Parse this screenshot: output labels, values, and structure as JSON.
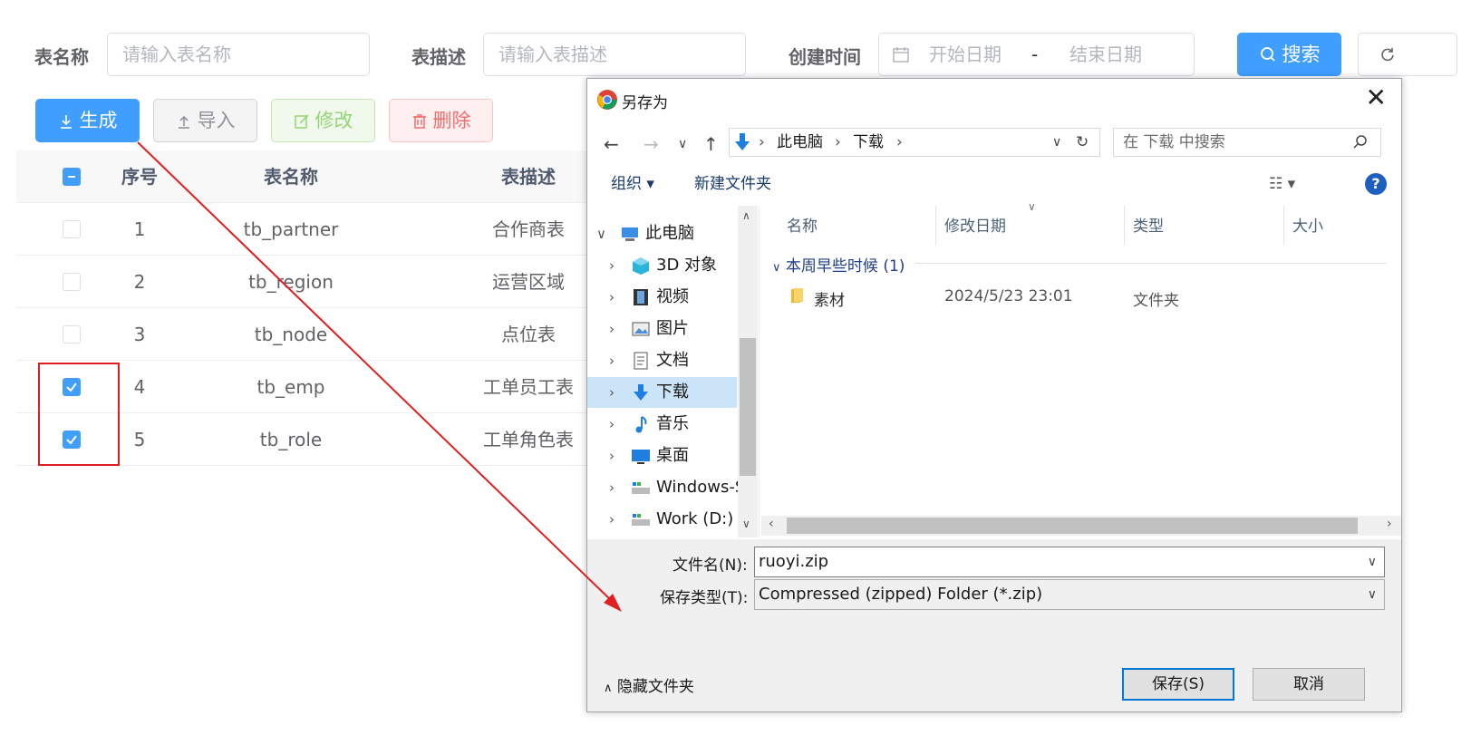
{
  "filter": {
    "table_name_label": "表名称",
    "table_name_placeholder": "请输入表名称",
    "table_desc_label": "表描述",
    "table_desc_placeholder": "请输入表描述",
    "create_time_label": "创建时间",
    "start_date_placeholder": "开始日期",
    "range_separator": "-",
    "end_date_placeholder": "结束日期",
    "search_button": "搜索"
  },
  "actions": {
    "generate": "生成",
    "import": "导入",
    "edit": "修改",
    "delete": "删除"
  },
  "table": {
    "headers": {
      "index": "序号",
      "name": "表名称",
      "desc": "表描述"
    },
    "rows": [
      {
        "index": "1",
        "name": "tb_partner",
        "desc": "合作商表",
        "checked": false
      },
      {
        "index": "2",
        "name": "tb_region",
        "desc": "运营区域",
        "checked": false
      },
      {
        "index": "3",
        "name": "tb_node",
        "desc": "点位表",
        "checked": false
      },
      {
        "index": "4",
        "name": "tb_emp",
        "desc": "工单员工表",
        "checked": true
      },
      {
        "index": "5",
        "name": "tb_role",
        "desc": "工单角色表",
        "checked": true
      }
    ]
  },
  "dialog": {
    "title": "另存为",
    "address": {
      "root": "此电脑",
      "folder": "下载"
    },
    "search_placeholder": "在 下载 中搜索",
    "organize": "组织 ▾",
    "new_folder": "新建文件夹",
    "help": "?",
    "nav": [
      {
        "label": "此电脑",
        "icon": "computer-icon"
      },
      {
        "label": "3D 对象",
        "icon": "cube-icon"
      },
      {
        "label": "视频",
        "icon": "film-icon"
      },
      {
        "label": "图片",
        "icon": "picture-icon"
      },
      {
        "label": "文档",
        "icon": "document-icon"
      },
      {
        "label": "下载",
        "icon": "download-icon"
      },
      {
        "label": "音乐",
        "icon": "music-icon"
      },
      {
        "label": "桌面",
        "icon": "desktop-icon"
      },
      {
        "label": "Windows-S",
        "icon": "drive-icon"
      },
      {
        "label": "Work (D:)",
        "icon": "drive-icon"
      }
    ],
    "columns": {
      "name": "名称",
      "modified": "修改日期",
      "type": "类型",
      "size": "大小"
    },
    "group": "本周早些时候 (1)",
    "file": {
      "name": "素材",
      "modified": "2024/5/23 23:01",
      "type": "文件夹"
    },
    "filename_label": "文件名(N):",
    "filename_value": "ruoyi.zip",
    "filetype_label": "保存类型(T):",
    "filetype_value": "Compressed (zipped) Folder (*.zip)",
    "hide_folders": "隐藏文件夹",
    "save_button": "保存(S)",
    "cancel_button": "取消"
  },
  "colors": {
    "primary": "#409eff",
    "annotation": "#e02020",
    "selection": "#cce4f7"
  }
}
